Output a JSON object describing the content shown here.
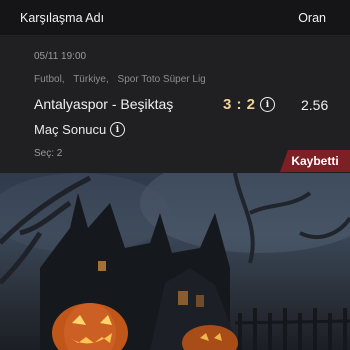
{
  "header": {
    "title": "Karşılaşma Adı",
    "odds_label": "Oran"
  },
  "bet": {
    "date": "05/11 19:00",
    "league_path": [
      "Futbol,",
      "Türkiye,",
      "Spor Toto Süper Lig"
    ],
    "teams": "Antalyaspor - Beşiktaş",
    "score": "3 : 2",
    "odd": "2.56",
    "market": "Maç Sonucu",
    "selection": "Seç: 2",
    "status": "Kaybetti",
    "info_icon_glyph": "i"
  },
  "icons": [
    "info-icon"
  ],
  "colors": {
    "score": "#f1d39a",
    "status_badge": "#7d2025",
    "header_bg": "#151517",
    "card_bg": "#202023"
  }
}
